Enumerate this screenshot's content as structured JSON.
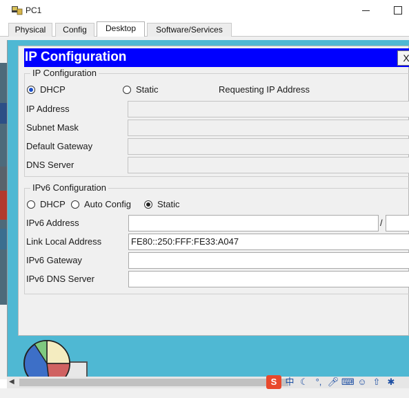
{
  "window": {
    "title": "PC1"
  },
  "tabs": [
    "Physical",
    "Config",
    "Desktop",
    "Software/Services"
  ],
  "active_tab": "Desktop",
  "ip_config": {
    "header_title": "IP Configuration",
    "close_label": "X",
    "ipv4_group_label": "IP Configuration",
    "mode_dhcp": "DHCP",
    "mode_static": "Static",
    "selected_mode": "DHCP",
    "status_text": "Requesting IP Address",
    "ip_address_label": "IP Address",
    "ip_address_value": "",
    "subnet_mask_label": "Subnet Mask",
    "subnet_mask_value": "",
    "default_gateway_label": "Default Gateway",
    "default_gateway_value": "",
    "dns_server_label": "DNS Server",
    "dns_server_value": ""
  },
  "ipv6_config": {
    "group_label": "IPv6 Configuration",
    "mode_dhcp": "DHCP",
    "mode_auto": "Auto Config",
    "mode_static": "Static",
    "selected_mode": "Static",
    "address_label": "IPv6 Address",
    "address_value": "",
    "prefix_separator": "/",
    "prefix_value": "",
    "link_local_label": "Link Local Address",
    "link_local_value": "FE80::250:FFF:FE33:A047",
    "gateway_label": "IPv6 Gateway",
    "gateway_value": "",
    "dns_label": "IPv6 DNS Server",
    "dns_value": ""
  },
  "tray_icons": [
    "sogou-input-icon",
    "chinese-mode-icon",
    "moon-icon",
    "punctuation-icon",
    "microphone-icon",
    "keyboard-icon",
    "user-icon",
    "shirt-icon",
    "tools-icon"
  ],
  "tray_labels": {
    "sogou": "S",
    "chinese": "中"
  },
  "colors": {
    "header_blue": "#0000ff",
    "desktop_teal": "#4fb8d3"
  }
}
